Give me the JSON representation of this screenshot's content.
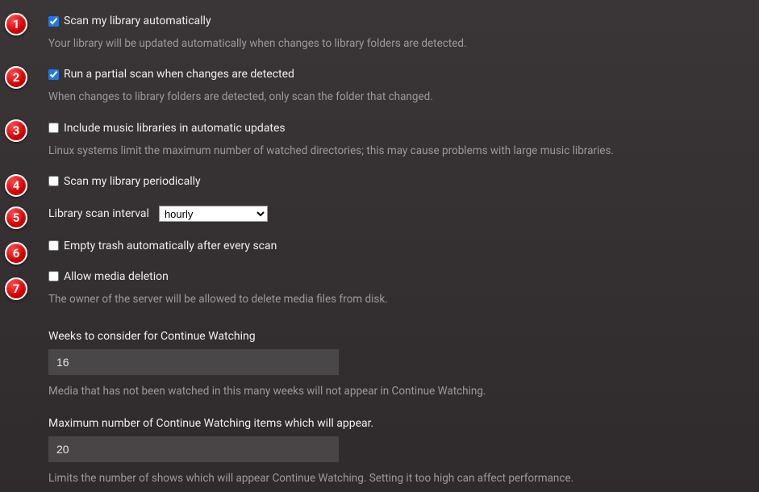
{
  "settings": {
    "scanAuto": {
      "label": "Scan my library automatically",
      "desc": "Your library will be updated automatically when changes to library folders are detected.",
      "checked": true
    },
    "partialScan": {
      "label": "Run a partial scan when changes are detected",
      "desc": "When changes to library folders are detected, only scan the folder that changed.",
      "checked": true
    },
    "includeMusic": {
      "label": "Include music libraries in automatic updates",
      "desc": "Linux systems limit the maximum number of watched directories; this may cause problems with large music libraries.",
      "checked": false
    },
    "scanPeriodic": {
      "label": "Scan my library periodically",
      "checked": false
    },
    "scanInterval": {
      "label": "Library scan interval",
      "selected": "hourly"
    },
    "emptyTrash": {
      "label": "Empty trash automatically after every scan",
      "checked": false
    },
    "allowDeletion": {
      "label": "Allow media deletion",
      "desc": "The owner of the server will be allowed to delete media files from disk.",
      "checked": false
    },
    "continueWeeks": {
      "label": "Weeks to consider for Continue Watching",
      "value": "16",
      "desc": "Media that has not been watched in this many weeks will not appear in Continue Watching."
    },
    "continueMax": {
      "label": "Maximum number of Continue Watching items which will appear.",
      "value": "20",
      "desc": "Limits the number of shows which will appear Continue Watching. Setting it too high can affect performance."
    }
  },
  "markers": [
    "1",
    "2",
    "3",
    "4",
    "5",
    "6",
    "7"
  ]
}
